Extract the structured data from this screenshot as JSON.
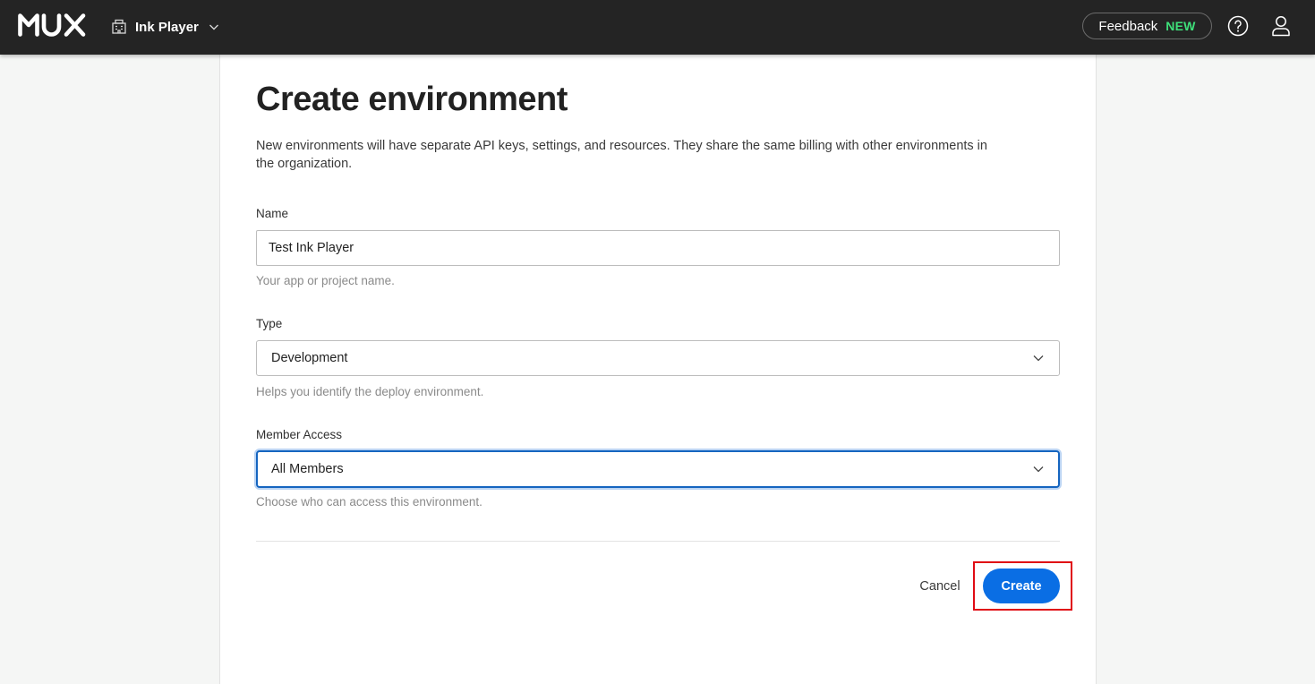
{
  "app": {
    "logo_text": "MUX",
    "environment_name": "Ink Player",
    "feedback_label": "Feedback",
    "feedback_badge": "NEW",
    "icons": {
      "environment": "building-icon",
      "environment_menu": "chevron-down-icon",
      "help": "question-circle-icon",
      "user": "user-icon"
    }
  },
  "form": {
    "title": "Create environment",
    "description": "New environments will have separate API keys, settings, and resources. They share the same billing with other environments in the organization.",
    "name": {
      "label": "Name",
      "value": "Test Ink Player",
      "hint": "Your app or project name."
    },
    "type": {
      "label": "Type",
      "value": "Development",
      "hint": "Helps you identify the deploy environment."
    },
    "member_access": {
      "label": "Member Access",
      "value": "All Members",
      "hint": "Choose who can access this environment."
    },
    "cancel_label": "Cancel",
    "create_label": "Create"
  },
  "colors": {
    "topbar": "#242424",
    "primary": "#0a6ee4",
    "badge": "#3ee07a",
    "highlight": "#e00b14",
    "focus": "#1565c0"
  }
}
